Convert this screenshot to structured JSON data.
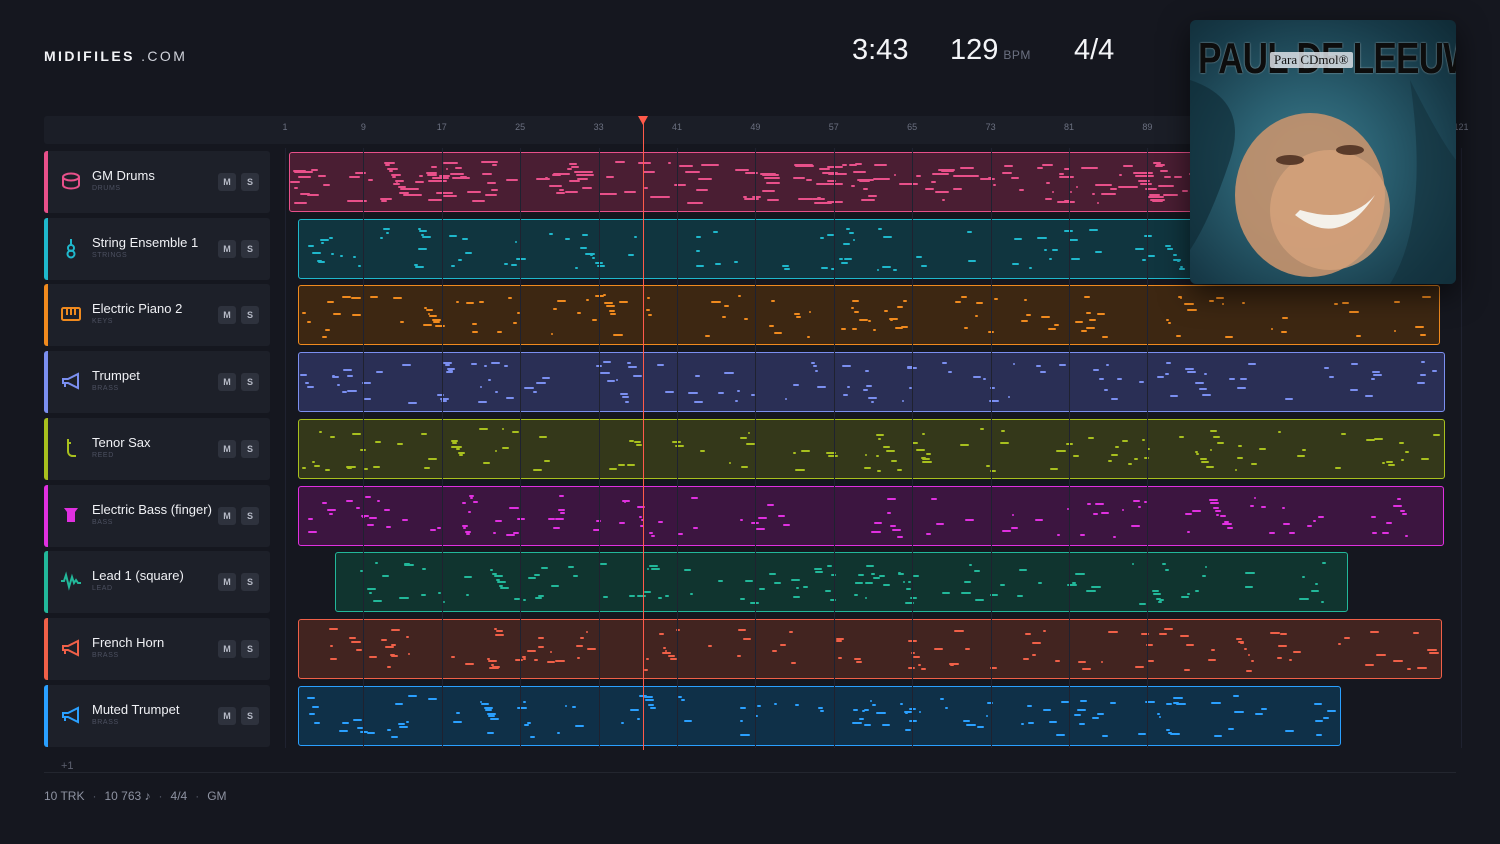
{
  "header": {
    "logo_bold": "MIDIFILES",
    "logo_light": ".COM",
    "duration": "3:43",
    "tempo": "129",
    "tempo_unit": "BPM",
    "time_signature": "4/4"
  },
  "ruler": {
    "bars": [
      "1",
      "9",
      "17",
      "25",
      "33",
      "41",
      "49",
      "57",
      "65",
      "73",
      "81",
      "89",
      "121"
    ]
  },
  "playhead": {
    "bar": 37.5
  },
  "tracks": [
    {
      "name": "GM Drums",
      "category": "DRUMS",
      "color": "#e8508a",
      "clip_bg": "#4a1e33",
      "icon": "drum-icon",
      "mute": "M",
      "solo": "S"
    },
    {
      "name": "String Ensemble 1",
      "category": "STRINGS",
      "color": "#1fb8cc",
      "clip_bg": "#10353f",
      "icon": "violin-icon",
      "mute": "M",
      "solo": "S"
    },
    {
      "name": "Electric Piano 2",
      "category": "KEYS",
      "color": "#f08a1e",
      "clip_bg": "#3d2712",
      "icon": "piano-icon",
      "mute": "M",
      "solo": "S"
    },
    {
      "name": "Trumpet",
      "category": "BRASS",
      "color": "#7b8ff0",
      "clip_bg": "#2a2f55",
      "icon": "horn-icon",
      "mute": "M",
      "solo": "S"
    },
    {
      "name": "Tenor Sax",
      "category": "REED",
      "color": "#a8c01e",
      "clip_bg": "#34381a",
      "icon": "sax-icon",
      "mute": "M",
      "solo": "S"
    },
    {
      "name": "Electric Bass (finger)",
      "category": "BASS",
      "color": "#e030e0",
      "clip_bg": "#3c1540",
      "icon": "bass-icon",
      "mute": "M",
      "solo": "S"
    },
    {
      "name": "Lead 1 (square)",
      "category": "LEAD",
      "color": "#22b89a",
      "clip_bg": "#10342f",
      "icon": "wave-icon",
      "mute": "M",
      "solo": "S"
    },
    {
      "name": "French Horn",
      "category": "BRASS",
      "color": "#f06048",
      "clip_bg": "#422420",
      "icon": "horn-icon",
      "mute": "M",
      "solo": "S"
    },
    {
      "name": "Muted Trumpet",
      "category": "BRASS",
      "color": "#2aa0ff",
      "clip_bg": "#0f3048",
      "icon": "horn-icon",
      "mute": "M",
      "solo": "S"
    }
  ],
  "more_tracks": "+1",
  "footer": {
    "tracks": "10 TRK",
    "notes": "10 763 ♪",
    "time_signature": "4/4",
    "standard": "GM"
  },
  "album": {
    "artist": "PAUL DE LEEUW",
    "title": "Para CDmol®"
  }
}
